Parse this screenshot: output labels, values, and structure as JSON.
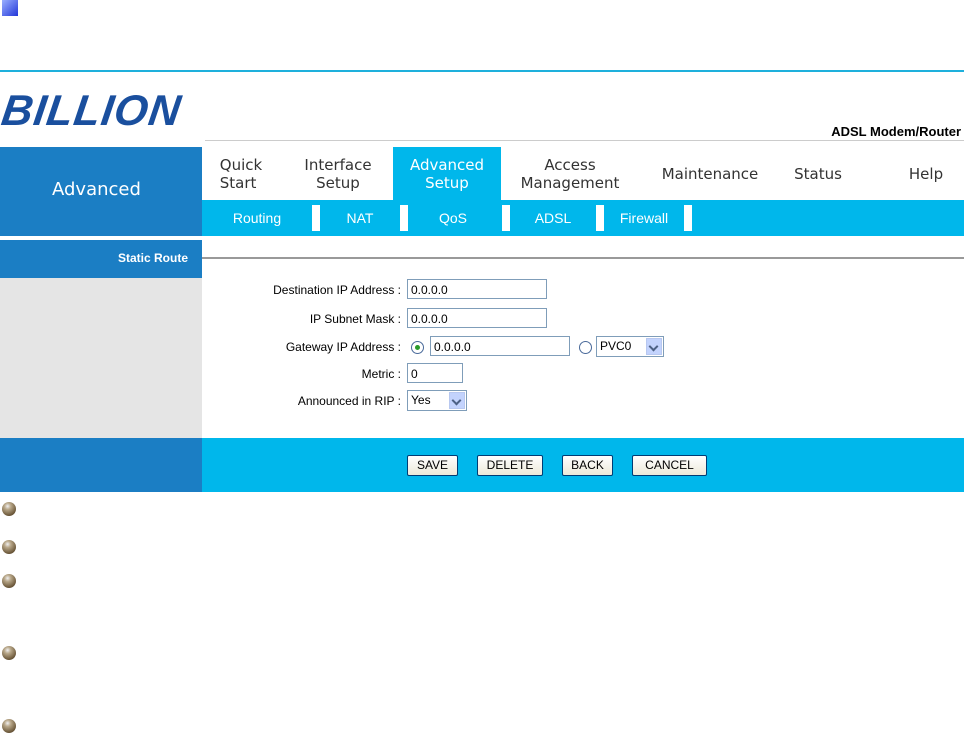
{
  "brand": {
    "logo_text": "BILLION",
    "product": "ADSL Modem/Router"
  },
  "side": {
    "section_title": "Advanced",
    "page_label": "Static Route"
  },
  "nav": {
    "items": [
      {
        "label": "Quick\nStart",
        "active": false
      },
      {
        "label": "Interface\nSetup",
        "active": false
      },
      {
        "label": "Advanced\nSetup",
        "active": true
      },
      {
        "label": "Access\nManagement",
        "active": false
      },
      {
        "label": "Maintenance",
        "active": false
      },
      {
        "label": "Status",
        "active": false
      },
      {
        "label": "Help",
        "active": false
      }
    ],
    "sub_items": [
      "Routing",
      "NAT",
      "QoS",
      "ADSL",
      "Firewall"
    ]
  },
  "form": {
    "dest_ip": {
      "label": "Destination IP Address :",
      "value": "0.0.0.0"
    },
    "subnet": {
      "label": "IP Subnet Mask :",
      "value": "0.0.0.0"
    },
    "gateway": {
      "label": "Gateway IP Address :",
      "value": "0.0.0.0",
      "pvc_value": "PVC0"
    },
    "metric": {
      "label": "Metric :",
      "value": "0"
    },
    "rip": {
      "label": "Announced in RIP :",
      "value": "Yes"
    }
  },
  "buttons": {
    "save": "SAVE",
    "delete": "DELETE",
    "back": "BACK",
    "cancel": "CANCEL"
  },
  "colors": {
    "accent": "#00b7eb",
    "side": "#1b7ec4",
    "logo": "#1a4f9e"
  }
}
